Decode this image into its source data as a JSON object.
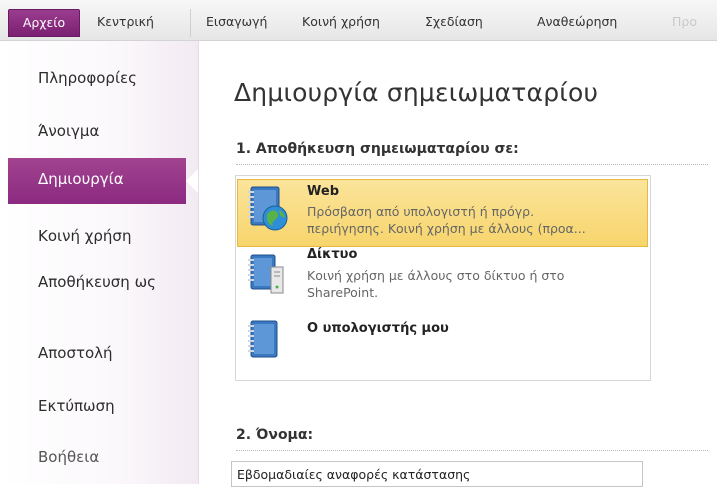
{
  "ribbon": {
    "tabs": [
      {
        "label": "Αρχείο"
      },
      {
        "label": "Κεντρική"
      },
      {
        "label": "Εισαγωγή"
      },
      {
        "label": "Κοινή χρήση"
      },
      {
        "label": "Σχεδίαση"
      },
      {
        "label": "Αναθεώρηση"
      },
      {
        "label": "Προ"
      }
    ]
  },
  "sidebar": {
    "items": [
      {
        "label": "Πληροφορίες"
      },
      {
        "label": "Άνοιγμα"
      },
      {
        "label": "Δημιουργία"
      },
      {
        "label": "Κοινή χρήση"
      },
      {
        "label": "Αποθήκευση ως"
      },
      {
        "label": "Αποστολή"
      },
      {
        "label": "Εκτύπωση"
      },
      {
        "label": "Βοήθεια"
      }
    ],
    "selected": "Δημιουργία"
  },
  "main": {
    "title": "Δημιουργία σημειωματαρίου",
    "section1": "1. Αποθήκευση σημειωματαρίου σε:",
    "locations": [
      {
        "title": "Web",
        "desc_line1": "Πρόσβαση από υπολογιστή ή πρόγρ.",
        "desc_line2": "περιήγησης. Κοινή χρήση με άλλους (προα...",
        "icon": "web-notebook-icon"
      },
      {
        "title": "Δίκτυο",
        "desc_line1": "Κοινή χρήση με άλλους στο δίκτυο ή στο",
        "desc_line2": "SharePoint.",
        "icon": "network-notebook-icon"
      },
      {
        "title": "Ο υπολογιστής μου",
        "desc_line1": "",
        "desc_line2": "",
        "icon": "local-notebook-icon"
      }
    ],
    "section2": "2. Όνομα:",
    "name_value": "Εβδομαδιαίες αναφορές κατάστασης"
  },
  "colors": {
    "accent": "#8b2a80",
    "selection": "#f7d56c"
  }
}
